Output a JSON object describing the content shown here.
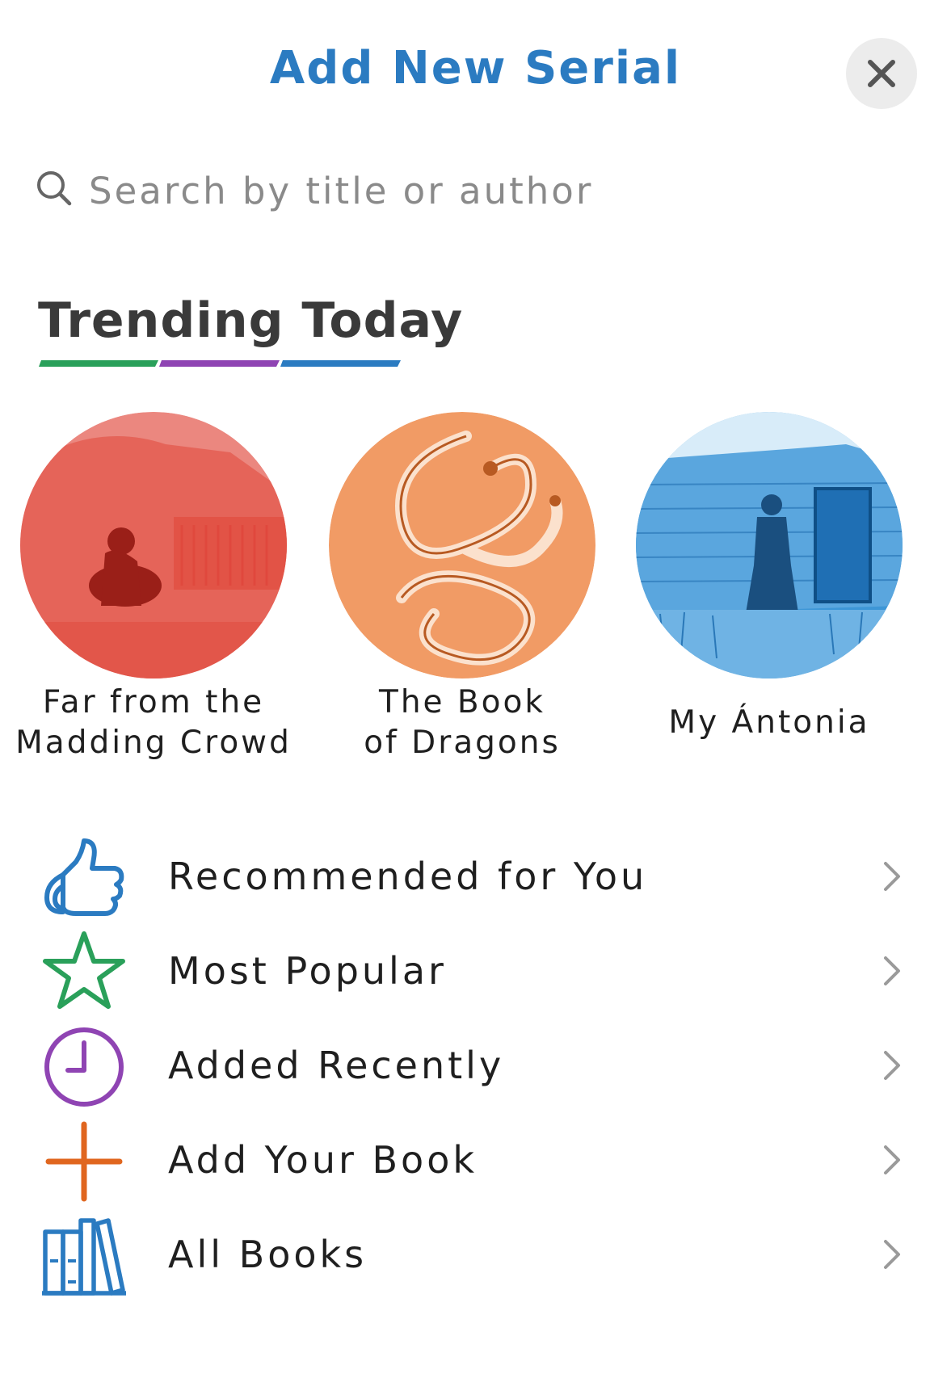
{
  "header": {
    "title": "Add New Serial",
    "close_icon": "close-icon"
  },
  "search": {
    "placeholder": "Search by title or author",
    "value": "",
    "icon": "search-icon"
  },
  "trending": {
    "heading": "Trending Today",
    "underline_colors": [
      "#2aa05a",
      "#8f44b3",
      "#2b7bc1"
    ],
    "books": [
      {
        "title": "Far from the\nMadding Crowd",
        "color": "#e0473b"
      },
      {
        "title": "The Book\nof Dragons",
        "color": "#ef8a4a"
      },
      {
        "title": "My Ántonia",
        "color": "#3d96d6"
      }
    ]
  },
  "menu": {
    "items": [
      {
        "label": "Recommended for You",
        "icon": "thumbs-up-icon",
        "color": "#2b7bc1"
      },
      {
        "label": "Most Popular",
        "icon": "star-icon",
        "color": "#2aa05a"
      },
      {
        "label": "Added Recently",
        "icon": "clock-icon",
        "color": "#8f44b3"
      },
      {
        "label": "Add Your Book",
        "icon": "plus-icon",
        "color": "#e0661f"
      },
      {
        "label": "All Books",
        "icon": "books-icon",
        "color": "#2b7bc1"
      }
    ],
    "chevron_icon": "chevron-right-icon"
  }
}
